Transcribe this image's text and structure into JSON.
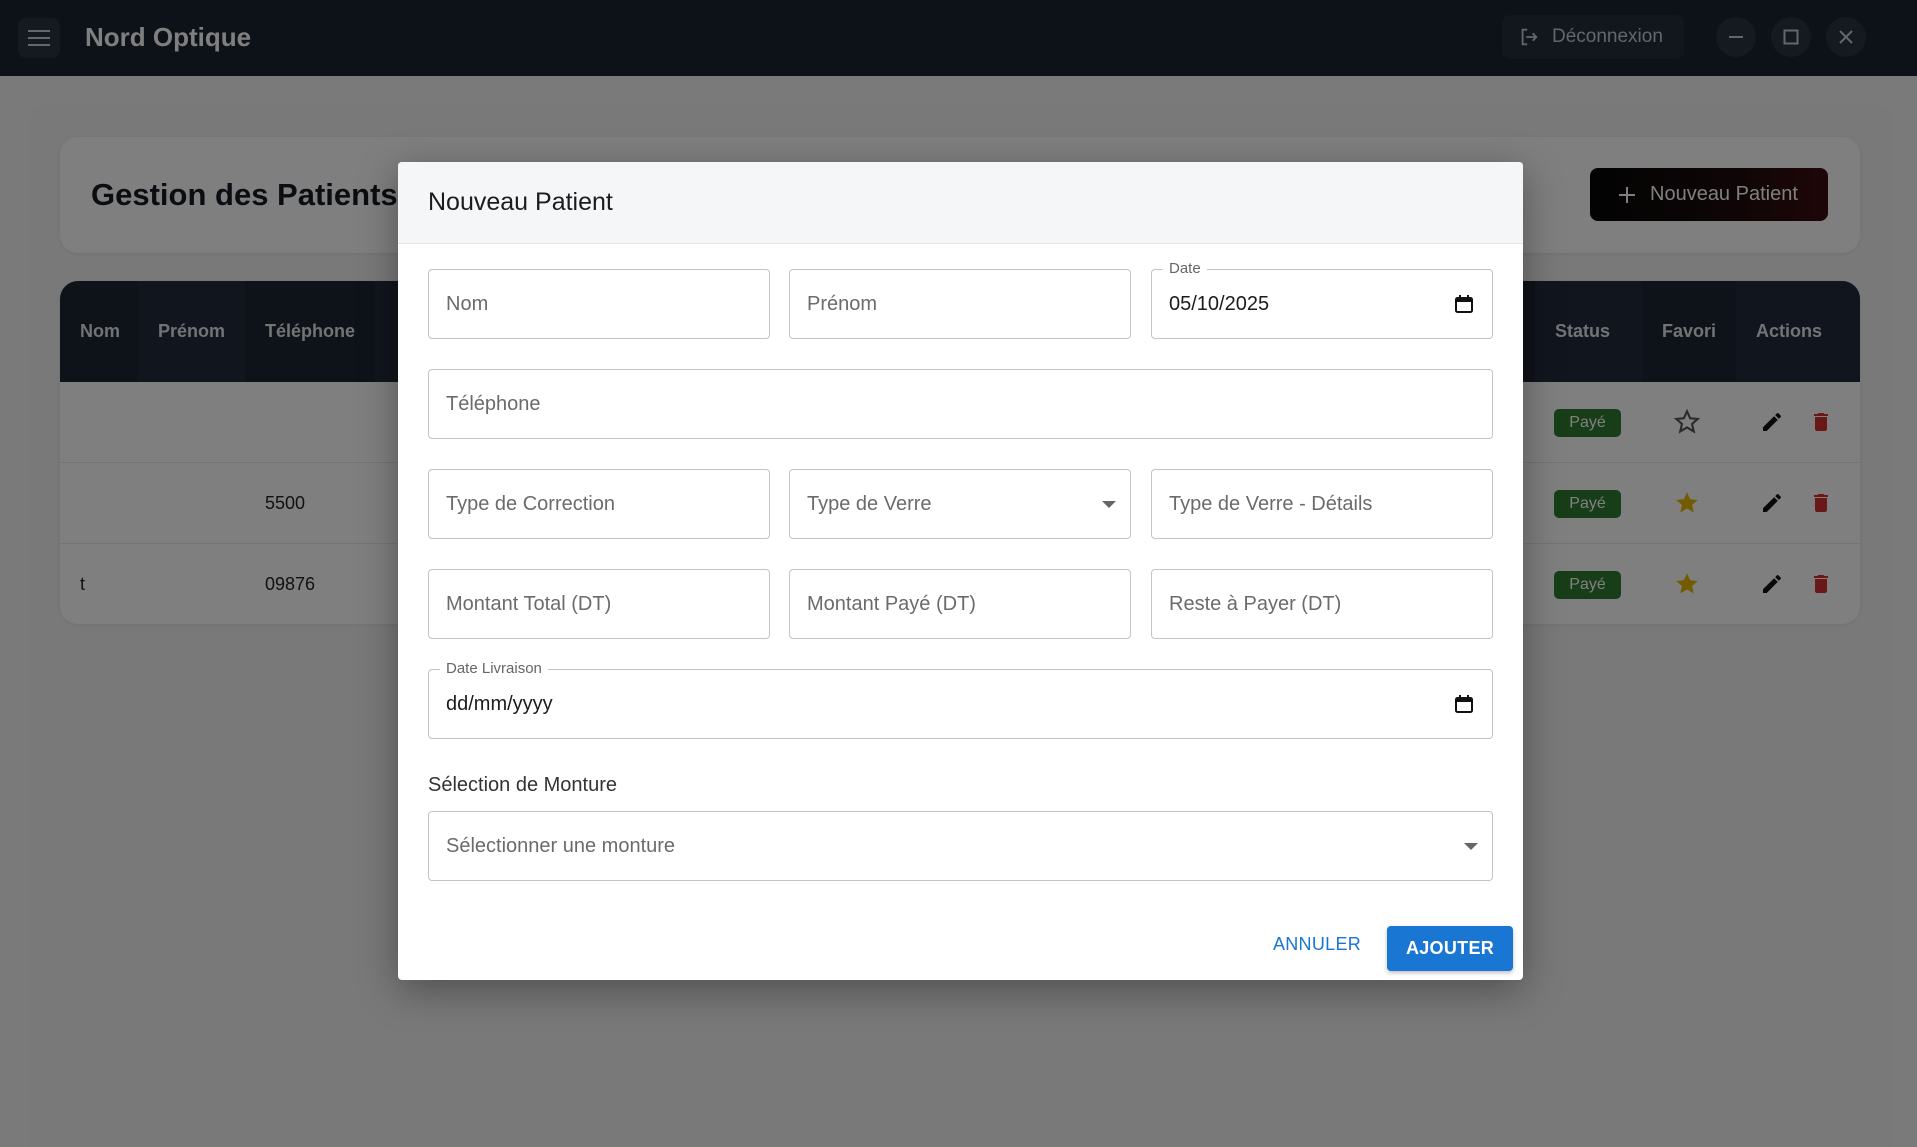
{
  "app": {
    "title": "Nord Optique",
    "logout_label": "Déconnexion"
  },
  "page": {
    "title": "Gestion des Patients",
    "new_patient_label": "Nouveau Patient"
  },
  "table": {
    "headers": [
      "Nom",
      "Prénom",
      "Téléphone",
      "Status",
      "Favori",
      "Actions"
    ],
    "rows": [
      {
        "nom": "",
        "telephone": "",
        "status": "Payé",
        "favori": false
      },
      {
        "nom": "",
        "telephone": "5500",
        "status": "Payé",
        "favori": true
      },
      {
        "nom": "t",
        "telephone": "09876",
        "status": "Payé",
        "favori": true
      }
    ]
  },
  "dialog": {
    "title": "Nouveau Patient",
    "fields": {
      "nom": "Nom",
      "prenom": "Prénom",
      "date_label": "Date",
      "date_value": "05/10/2025",
      "telephone": "Téléphone",
      "type_correction": "Type de Correction",
      "type_verre": "Type de Verre",
      "type_verre_details": "Type de Verre - Détails",
      "montant_total": "Montant Total (DT)",
      "montant_paye": "Montant Payé (DT)",
      "reste_a_payer": "Reste à Payer (DT)",
      "date_livraison_label": "Date Livraison",
      "date_livraison_value": "dd/mm/yyyy"
    },
    "monture_section": "Sélection de Monture",
    "monture_placeholder": "Sélectionner une monture",
    "cancel_label": "ANNULER",
    "add_label": "AJOUTER"
  },
  "colors": {
    "primary": "#1976d2",
    "paid_badge": "#2e7d32",
    "star": "#e6b800",
    "delete": "#d32f2f",
    "appbar": "#1b2330"
  }
}
